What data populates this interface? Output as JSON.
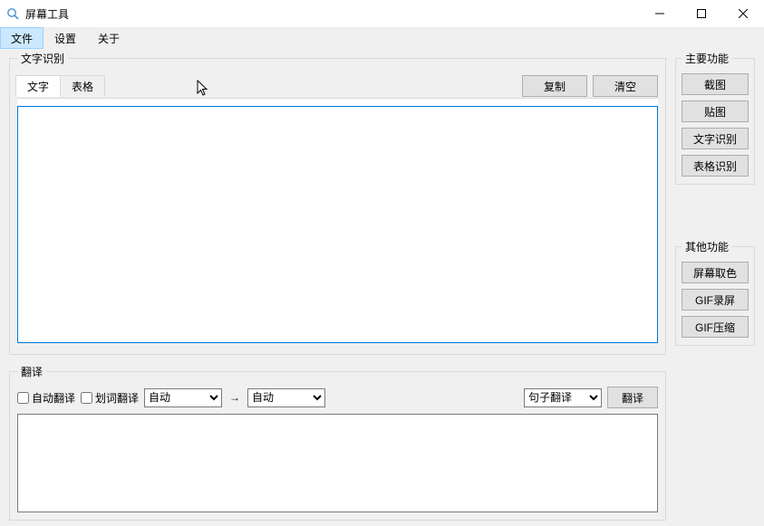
{
  "window": {
    "title": "屏幕工具"
  },
  "menu": {
    "file": "文件",
    "settings": "设置",
    "about": "关于"
  },
  "recognition": {
    "legend": "文字识别",
    "tabs": {
      "text": "文字",
      "table": "表格"
    },
    "copy_btn": "复制",
    "clear_btn": "清空",
    "content": ""
  },
  "translation": {
    "legend": "翻译",
    "auto_translate": "自动翻译",
    "word_translate": "划词翻译",
    "lang_from_selected": "自动",
    "lang_to_selected": "自动",
    "arrow": "→",
    "mode_selected": "句子翻译",
    "translate_btn": "翻译",
    "content": ""
  },
  "sidebar": {
    "main_legend": "主要功能",
    "main_buttons": [
      "截图",
      "贴图",
      "文字识别",
      "表格识别"
    ],
    "other_legend": "其他功能",
    "other_buttons": [
      "屏幕取色",
      "GIF录屏",
      "GIF压缩"
    ]
  }
}
